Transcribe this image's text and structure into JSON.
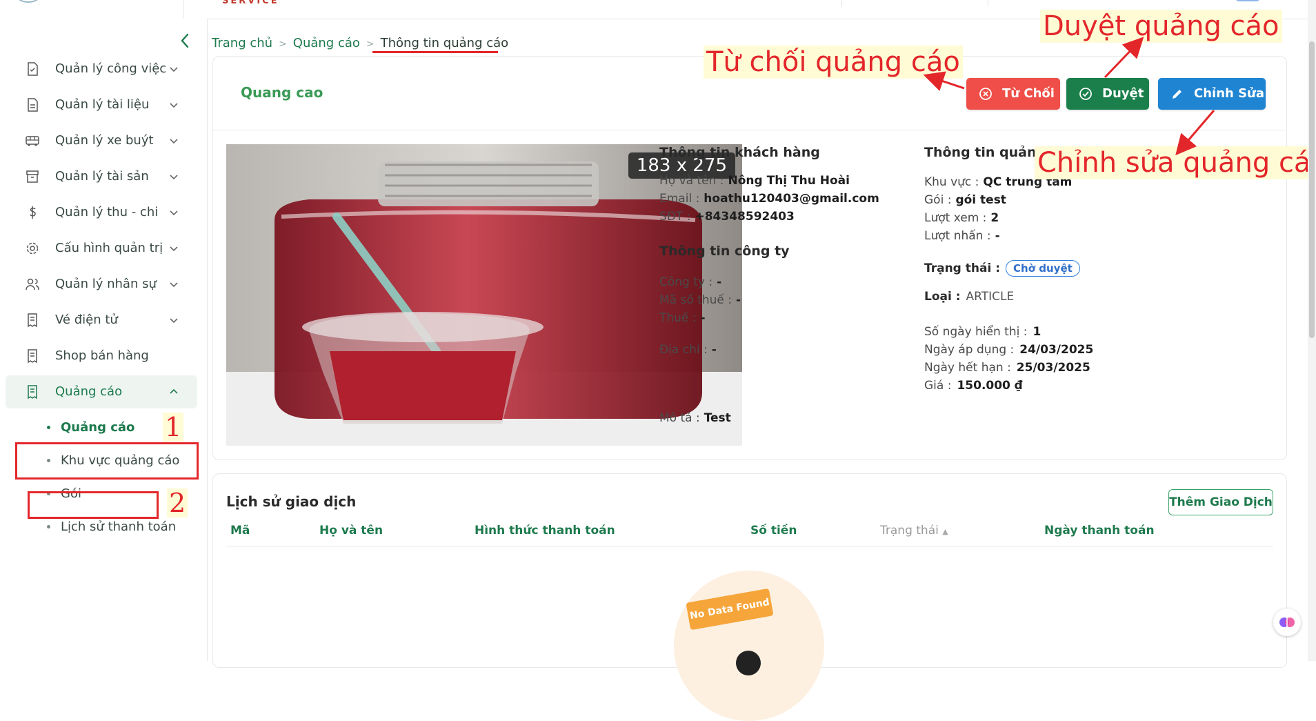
{
  "topbar": {
    "logo_text": "SERVICE"
  },
  "sidebar": {
    "items": [
      {
        "label": "Quản lý công việc",
        "icon": "task-icon"
      },
      {
        "label": "Quản lý tài liệu",
        "icon": "document-icon"
      },
      {
        "label": "Quản lý xe buýt",
        "icon": "bus-icon"
      },
      {
        "label": "Quản lý tài sản",
        "icon": "archive-icon"
      },
      {
        "label": "Quản lý thu - chi",
        "icon": "dollar-icon"
      },
      {
        "label": "Cấu hình quản trị",
        "icon": "gear-icon"
      },
      {
        "label": "Quản lý nhân sự",
        "icon": "users-icon"
      },
      {
        "label": "Vé điện tử",
        "icon": "receipt-icon"
      },
      {
        "label": "Shop bán hàng",
        "icon": "receipt-icon"
      },
      {
        "label": "Quảng cáo",
        "icon": "receipt-icon"
      }
    ],
    "sub_items": [
      {
        "label": "Quảng cáo"
      },
      {
        "label": "Khu vực quảng cáo"
      },
      {
        "label": "Gói"
      },
      {
        "label": "Lịch sử thanh toán"
      }
    ]
  },
  "annotations": {
    "num1": "1",
    "num2": "2",
    "reject": "Từ chối quảng cáo",
    "approve": "Duyệt quảng cáo",
    "edit": "Chỉnh sửa quảng cáo"
  },
  "breadcrumb": {
    "home": "Trang chủ",
    "section": "Quảng cáo",
    "current": "Thông tin quảng cáo"
  },
  "ad": {
    "title": "Quang cao",
    "image_size": "183 x 275",
    "buttons": {
      "reject": "Từ Chối",
      "approve": "Duyệt",
      "edit": "Chỉnh Sửa"
    },
    "customer": {
      "heading": "Thông tin khách hàng",
      "name_label": "Họ và tên :",
      "name": "Nông Thị Thu Hoài",
      "email_label": "Email :",
      "email": "hoathu120403@gmail.com",
      "phone_label": "SĐT :",
      "phone": "+84348592403"
    },
    "company": {
      "heading": "Thông tin công ty",
      "company_label": "Công ty :",
      "company": "-",
      "tax_code_label": "Mã số thuế :",
      "tax_code": "-",
      "tax_label": "Thuế :",
      "tax": "-",
      "address_label": "Địa chỉ :",
      "address": "-"
    },
    "description_label": "Mô tả :",
    "description": "Test",
    "info": {
      "heading": "Thông tin quảng cáo",
      "area_label": "Khu vực :",
      "area": "QC trung tâm",
      "package_label": "Gói :",
      "package": "gói test",
      "views_label": "Lượt xem :",
      "views": "2",
      "clicks_label": "Lượt nhấn :",
      "clicks": "-",
      "status_label": "Trạng thái :",
      "status": "Chờ duyệt",
      "type_label": "Loại :",
      "type": "ARTICLE",
      "days_label": "Số ngày hiển thị :",
      "days": "1",
      "start_label": "Ngày áp dụng :",
      "start": "24/03/2025",
      "end_label": "Ngày hết hạn :",
      "end": "25/03/2025",
      "price_label": "Giá :",
      "price": "150.000 ₫"
    }
  },
  "history": {
    "title": "Lịch sử giao dịch",
    "add_button": "Thêm Giao Dịch",
    "columns": [
      "Mã",
      "Họ và tên",
      "Hình thức thanh toán",
      "Số tiền",
      "Trạng thái",
      "Ngày thanh toán"
    ],
    "empty_text": "No Data Found"
  },
  "colors": {
    "primary": "#1d7a4d",
    "reject": "#ef4f48",
    "approve": "#1a7f4b",
    "edit": "#1f84d2",
    "annotation": "#e3262a"
  }
}
